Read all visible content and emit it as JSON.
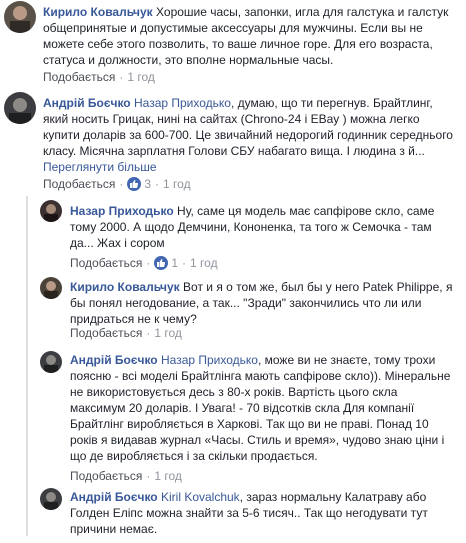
{
  "comments": [
    {
      "author": "Кирило Ковальчук",
      "text": "Хорошие часы, запонки, игла для галстука и галстук общепринятые и допустимые аксессуары для мужчины. Если вы не можете себе этого позволить, то ваше личное горе. Для его возраста, статуса и должности, это вполне нормальные часы.",
      "like": "Подобається",
      "time": "1 год"
    },
    {
      "author": "Андрій Боєчко",
      "mention": "Назар Приходько",
      "text": ", думаю, що ти перегнув. Брайтлинг, який носить Грицак, нині на сайтах (Chrono-24 і EBay ) можна легко купити доларів за 600-700. Це звичайний недорогий годинник середнього класу. Місячна зарплатня Голови СБУ набагато вища. І людина з й...",
      "see_more": "Переглянути більше",
      "like": "Подобається",
      "reactions": "3",
      "time": "1 год"
    },
    {
      "author": "Назар Приходько",
      "text": "Ну, саме ця модель має сапфірове скло, саме тому 2000. А щодо Демчини, Кононенка, та того ж Семочка - там да... Жах і сором",
      "like": "Подобається",
      "reactions": "1",
      "time": "1 год"
    },
    {
      "author": "Кирило Ковальчук",
      "text": "Вот и я о том же, был бы у него Patek Philippe, я бы понял негодование, а так... \"Зради\" закончились что ли или придраться не к чему?",
      "like": "Подобається",
      "time": "1 год"
    },
    {
      "author": "Андрій Боєчко",
      "mention": "Назар Приходько",
      "text": ", може ви не знаєте, тому трохи поясню - всі моделі Брайтлінга мають сапфірове скло)). Мінеральне не використовується десь з 80-х років. Вартість цього скла максимум 20 доларів. І Увага! - 70 відсотків скла Для компанії Брайтлінг виробляється в Харкові. Так що ви не праві. Понад 10 років я видавав журнал «Часы. Стиль и время», чудово знаю ціни і що де виробляється і за скільки продається.",
      "like": "Подобається",
      "time": "1 год"
    },
    {
      "author": "Андрій Боєчко",
      "mention": "Kiril Kovalchuk",
      "text": ", зараз нормальну Калатраву або Голден Еліпс можна знайти за 5-6 тисяч.. Так що негодувати тут причини немає.",
      "like": "",
      "time": ""
    }
  ],
  "colors": {
    "link": "#385898",
    "meta": "#90949c",
    "reaction_blue": "#4267b2"
  },
  "icons": {
    "reaction": "like-thumb-icon"
  }
}
